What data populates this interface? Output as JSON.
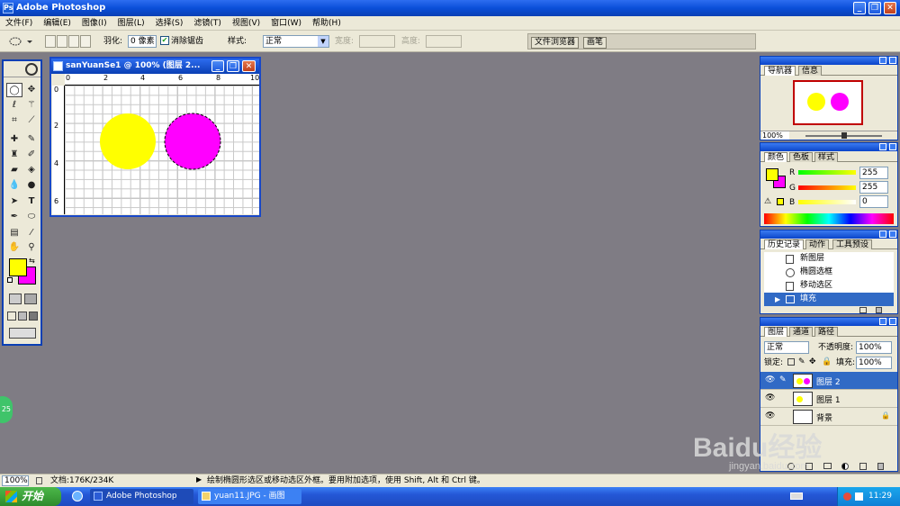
{
  "window": {
    "title": "Adobe Photoshop",
    "icon": "photoshop-app-icon",
    "app_icon_glyph": "Ps",
    "min_glyph": "_",
    "restore_glyph": "❐",
    "close_glyph": "✕"
  },
  "menu": [
    "文件(F)",
    "编辑(E)",
    "图像(I)",
    "图层(L)",
    "选择(S)",
    "滤镜(T)",
    "视图(V)",
    "窗口(W)",
    "帮助(H)"
  ],
  "options": {
    "feather_label": "羽化:",
    "feather_value": "0 像素",
    "antialias_label": "消除锯齿",
    "antialias_checked": true,
    "style_label": "样式:",
    "style_value": "正常",
    "width_label": "宽度:",
    "height_label": "高度:",
    "wells": [
      "文件浏览器",
      "画笔"
    ]
  },
  "document": {
    "title": "sanYuanSe1 @ 100% (图层 2...",
    "ruler_top_ticks": [
      "0",
      "2",
      "4",
      "6",
      "8",
      "10"
    ],
    "ruler_left_ticks": [
      "0",
      "2",
      "4",
      "6"
    ],
    "circles": [
      {
        "name": "yellow-circle",
        "color": "#ffff00",
        "selected": false
      },
      {
        "name": "magenta-circle",
        "color": "#ff00ff",
        "selected": true
      }
    ]
  },
  "colors": {
    "foreground": "#ffff00",
    "background": "#ff00ff",
    "title_blue": "#0a3fb4",
    "selection_blue": "#316ac5"
  },
  "navigator": {
    "tabs": [
      "导航器",
      "信息"
    ],
    "zoom": "100%"
  },
  "color_panel": {
    "tabs": [
      "颜色",
      "色板",
      "样式"
    ],
    "channels": [
      {
        "label": "R",
        "value": "255"
      },
      {
        "label": "G",
        "value": "255"
      },
      {
        "label": "B",
        "value": "0"
      }
    ]
  },
  "history": {
    "tabs": [
      "历史记录",
      "动作",
      "工具预设"
    ],
    "items": [
      {
        "label": "新图层",
        "icon": "document-icon"
      },
      {
        "label": "椭圆选框",
        "icon": "ellipse-icon"
      },
      {
        "label": "移动选区",
        "icon": "document-icon"
      },
      {
        "label": "填充",
        "icon": "fill-icon",
        "selected": true
      }
    ]
  },
  "layers": {
    "tabs": [
      "图层",
      "通道",
      "路径"
    ],
    "blend_mode": "正常",
    "opacity_label": "不透明度:",
    "opacity": "100%",
    "lock_label": "锁定:",
    "fill_label": "填充:",
    "fill": "100%",
    "items": [
      {
        "name": "图层 2",
        "selected": true
      },
      {
        "name": "图层 1",
        "selected": false
      },
      {
        "name": "背景",
        "selected": false,
        "locked": true
      }
    ]
  },
  "status": {
    "zoom": "100%",
    "doc_info": "文档:176K/234K",
    "hint": "绘制椭圆形选区或移动选区外框。要用附加选项，使用 Shift, Alt 和 Ctrl 键。"
  },
  "taskbar": {
    "start": "开始",
    "items": [
      "Adobe Photoshop",
      "yuan11.JPG - 画图"
    ],
    "clock": "11:29"
  },
  "watermark": {
    "text": "Baidu经验",
    "subtext": "jingyan.baidu.com"
  },
  "floating_badge": "25"
}
